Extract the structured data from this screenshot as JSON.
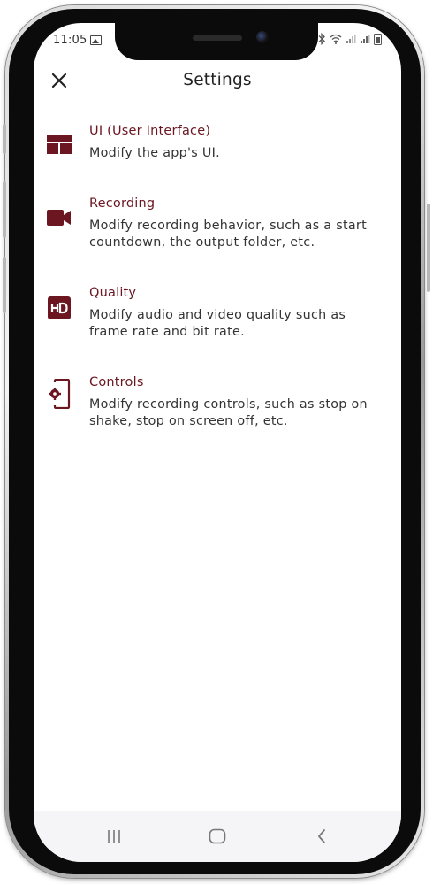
{
  "status_bar": {
    "time": "11:05"
  },
  "app_bar": {
    "title": "Settings",
    "close_icon": "close-icon"
  },
  "settings": {
    "items": [
      {
        "title": "UI (User Interface)",
        "description": "Modify the app's UI.",
        "icon": "layout-icon"
      },
      {
        "title": "Recording",
        "description": "Modify recording behavior, such as a start countdown, the output folder, etc.",
        "icon": "video-camera-icon"
      },
      {
        "title": "Quality",
        "description": "Modify audio and video quality such as frame rate and bit rate.",
        "icon": "hd-icon"
      },
      {
        "title": "Controls",
        "description": "Modify recording controls, such as stop on shake, stop on screen off, etc.",
        "icon": "phone-settings-icon"
      }
    ]
  },
  "nav_bar": {
    "recent_icon": "recent-apps-icon",
    "home_icon": "home-icon",
    "back_icon": "back-icon"
  },
  "colors": {
    "accent": "#6b1620",
    "text": "#333333",
    "nav_background": "#f5f5f7"
  }
}
